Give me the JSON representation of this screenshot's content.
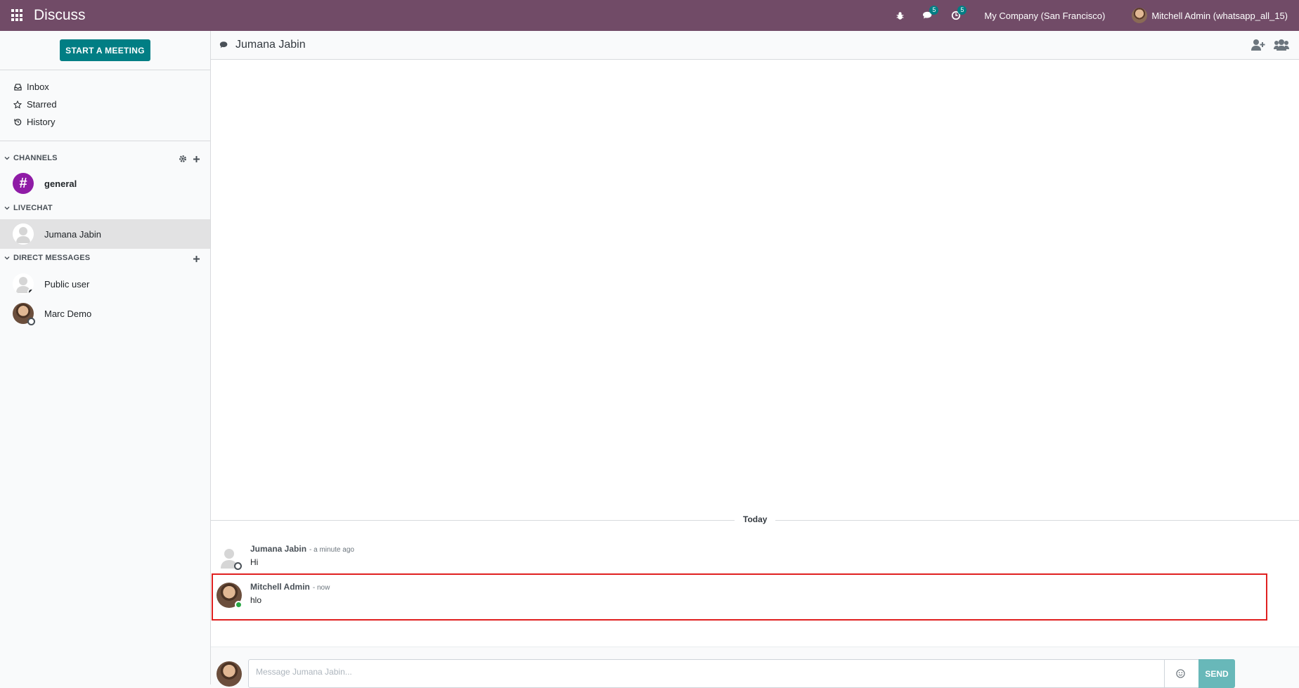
{
  "navbar": {
    "app_name": "Discuss",
    "messages_badge": "5",
    "activities_badge": "5",
    "company": "My Company (San Francisco)",
    "user": "Mitchell Admin (whatsapp_all_15)"
  },
  "sidebar": {
    "start_meeting": "START A MEETING",
    "mailboxes": [
      {
        "label": "Inbox",
        "icon": "inbox-icon"
      },
      {
        "label": "Starred",
        "icon": "star-icon"
      },
      {
        "label": "History",
        "icon": "history-icon"
      }
    ],
    "channels_header": "CHANNELS",
    "channels": [
      {
        "label": "general"
      }
    ],
    "livechat_header": "LIVECHAT",
    "livechat": [
      {
        "label": "Jumana Jabin"
      }
    ],
    "direct_header": "DIRECT MESSAGES",
    "direct": [
      {
        "label": "Public user"
      },
      {
        "label": "Marc Demo"
      }
    ]
  },
  "thread": {
    "title": "Jumana Jabin",
    "day_separator": "Today",
    "messages": [
      {
        "author": "Jumana Jabin",
        "date": "- a minute ago",
        "body": "Hi"
      },
      {
        "author": "Mitchell Admin",
        "date": "- now",
        "body": "hlo"
      }
    ]
  },
  "composer": {
    "placeholder": "Message Jumana Jabin...",
    "send_label": "SEND"
  },
  "colors": {
    "navbar": "#714b67",
    "primary": "#017e84",
    "channel_avatar": "#8f1ba6",
    "highlight_border": "#e02020"
  }
}
